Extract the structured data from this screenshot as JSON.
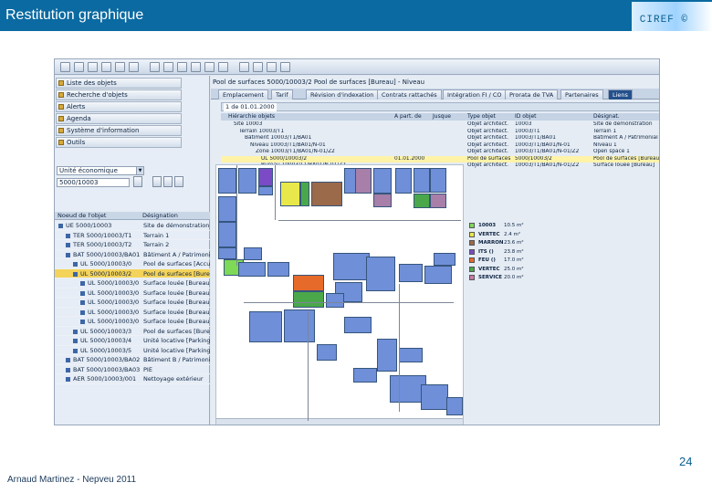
{
  "slide": {
    "title": "Restitution graphique",
    "brand": "CIREF ©",
    "page_number": "24",
    "author": "Arnaud Martinez - Nepveu 2011"
  },
  "sap": {
    "nav_items": [
      {
        "label": "Liste des objets",
        "icon": "list-icon"
      },
      {
        "label": "Recherche d'objets",
        "icon": "search-icon"
      },
      {
        "label": "Alerts",
        "icon": "alert-icon"
      },
      {
        "label": "Agenda",
        "icon": "calendar-icon"
      },
      {
        "label": "Système d'information",
        "icon": "info-icon"
      },
      {
        "label": "Outils",
        "icon": "tools-icon"
      }
    ],
    "unit_select": "Unité économique",
    "object_number": "5000/10003",
    "tree_header": {
      "col1": "Noeud de l'objet",
      "col2": "Désignation"
    },
    "tree": [
      {
        "id": "UE 5000/10003",
        "desc": "Site de démonstration",
        "indent": 0,
        "selected": false
      },
      {
        "id": "TER 5000/10003/T1",
        "desc": "Terrain 1",
        "indent": 1,
        "selected": false
      },
      {
        "id": "TER 5000/10003/T2",
        "desc": "Terrain 2",
        "indent": 1,
        "selected": false
      },
      {
        "id": "BAT 5000/10003/BA01",
        "desc": "Bâtiment A / Patrimonial",
        "indent": 1,
        "selected": false
      },
      {
        "id": "UL 5000/10003/0",
        "desc": "Pool de surfaces [Accueil]",
        "indent": 2,
        "selected": false
      },
      {
        "id": "UL 5000/10003/2",
        "desc": "Pool de surfaces [Bureau]",
        "indent": 2,
        "selected": true
      },
      {
        "id": "UL 5000/10003/0",
        "desc": "Surface louée [Bureau]",
        "indent": 3,
        "selected": false
      },
      {
        "id": "UL 5000/10003/0",
        "desc": "Surface louée [Bureau]",
        "indent": 3,
        "selected": false
      },
      {
        "id": "UL 5000/10003/0",
        "desc": "Surface louée [Bureau]",
        "indent": 3,
        "selected": false
      },
      {
        "id": "UL 5000/10003/0",
        "desc": "Surface louée [Bureau]",
        "indent": 3,
        "selected": false
      },
      {
        "id": "UL 5000/10003/0",
        "desc": "Surface louée [Bureau]",
        "indent": 3,
        "selected": false
      },
      {
        "id": "UL 5000/10003/3",
        "desc": "Pool de surfaces [Bureau]",
        "indent": 2,
        "selected": false
      },
      {
        "id": "UL 5000/10003/4",
        "desc": "Unité locative [Parking]",
        "indent": 2,
        "selected": false
      },
      {
        "id": "UL 5000/10003/5",
        "desc": "Unité locative [Parking]",
        "indent": 2,
        "selected": false
      },
      {
        "id": "BAT 5000/10003/BA02",
        "desc": "Bâtiment B / Patrimonial",
        "indent": 1,
        "selected": false
      },
      {
        "id": "BAT 5000/10003/BA03",
        "desc": "PIE",
        "indent": 1,
        "selected": false
      },
      {
        "id": "AER 5000/10003/001",
        "desc": "Nettoyage extérieur",
        "indent": 1,
        "selected": false
      }
    ],
    "main": {
      "object_title": "Pool de surfaces    5000/10003/2    Pool de surfaces [Bureau] - Niveau",
      "tabs": [
        "Emplacement",
        "Tarif",
        "Révision d'indexation",
        "Contrats rattachés",
        "Intégration FI / CO",
        "Prorata de TVA",
        "Partenaires",
        "Liens"
      ],
      "active_tab": 7,
      "date_field": "1 de 01.01.2000",
      "hier_columns": [
        "Hiérarchie objets",
        "A part. de",
        "Jusque",
        "Type objet",
        "ID objet",
        "Désignat."
      ],
      "hier_rows": [
        {
          "c1": "Site 10003",
          "c2": "",
          "c3": "",
          "c4": "Objet architect.",
          "c5": "10003",
          "c6": "Site de démonstration",
          "indent": 1,
          "hl": false
        },
        {
          "c1": "Terrain 10003/T1",
          "c2": "",
          "c3": "",
          "c4": "Objet architect.",
          "c5": "10003/T1",
          "c6": "Terrain 1",
          "indent": 2,
          "hl": false
        },
        {
          "c1": "Bâtiment 10003/T1/BA01",
          "c2": "",
          "c3": "",
          "c4": "Objet architect.",
          "c5": "10003/T1/BA01",
          "c6": "Bâtiment A / Patrimonial",
          "indent": 3,
          "hl": false
        },
        {
          "c1": "Niveau 10003/T1/BA01/N-01",
          "c2": "",
          "c3": "",
          "c4": "Objet architect.",
          "c5": "10003/T1/BA01/N-01",
          "c6": "Niveau 1",
          "indent": 4,
          "hl": false
        },
        {
          "c1": "Zone 10003/T1/BA01/N-01/Z2",
          "c2": "",
          "c3": "",
          "c4": "Objet architect.",
          "c5": "10003/T1/BA01/N-01/Z2",
          "c6": "Open space 1",
          "indent": 5,
          "hl": false
        },
        {
          "c1": "UL 5000/10003/2",
          "c2": "01.01.2000",
          "c3": "",
          "c4": "Pool de surfaces",
          "c5": "5000/10003/2",
          "c6": "Pool de surfaces [Bureau]",
          "indent": 6,
          "hl": true
        },
        {
          "c1": "Bureau 10003/T1/BA01/N-01/Z2",
          "c2": "",
          "c3": "",
          "c4": "Objet architect.",
          "c5": "10003/T1/BA01/N-01/Z2",
          "c6": "Surface louée [Bureau]",
          "indent": 6,
          "hl": false
        }
      ]
    },
    "legend": [
      {
        "label": "10003",
        "value": "10.5 m²",
        "color": "#7ed957"
      },
      {
        "label": "VERTEC",
        "value": "2.4 m²",
        "color": "#e8e84a"
      },
      {
        "label": "MARRON",
        "value": "23.6 m²",
        "color": "#9a6a4a"
      },
      {
        "label": "ITS ()",
        "value": "23.8 m²",
        "color": "#7a4bc4"
      },
      {
        "label": "FEU ()",
        "value": "17.0 m²",
        "color": "#e66a2a"
      },
      {
        "label": "VERTEC",
        "value": "25.0 m²",
        "color": "#4aa84a"
      },
      {
        "label": "SERVICE",
        "value": "20.0 m²",
        "color": "#c77aa8"
      }
    ]
  }
}
